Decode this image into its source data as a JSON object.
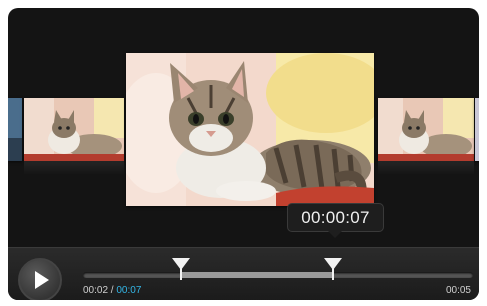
{
  "player": {
    "current_time": "00:02",
    "separator": " / ",
    "position_time": "00:07",
    "duration": "00:05",
    "bubble_time": "00:00:07"
  },
  "colors": {
    "background": "#141414",
    "position_accent": "#33b5e5",
    "marker": "#f2f2f2"
  },
  "icons": {
    "play": "play-icon",
    "trim_start": "trim-start-marker",
    "trim_end": "trim-end-marker"
  }
}
